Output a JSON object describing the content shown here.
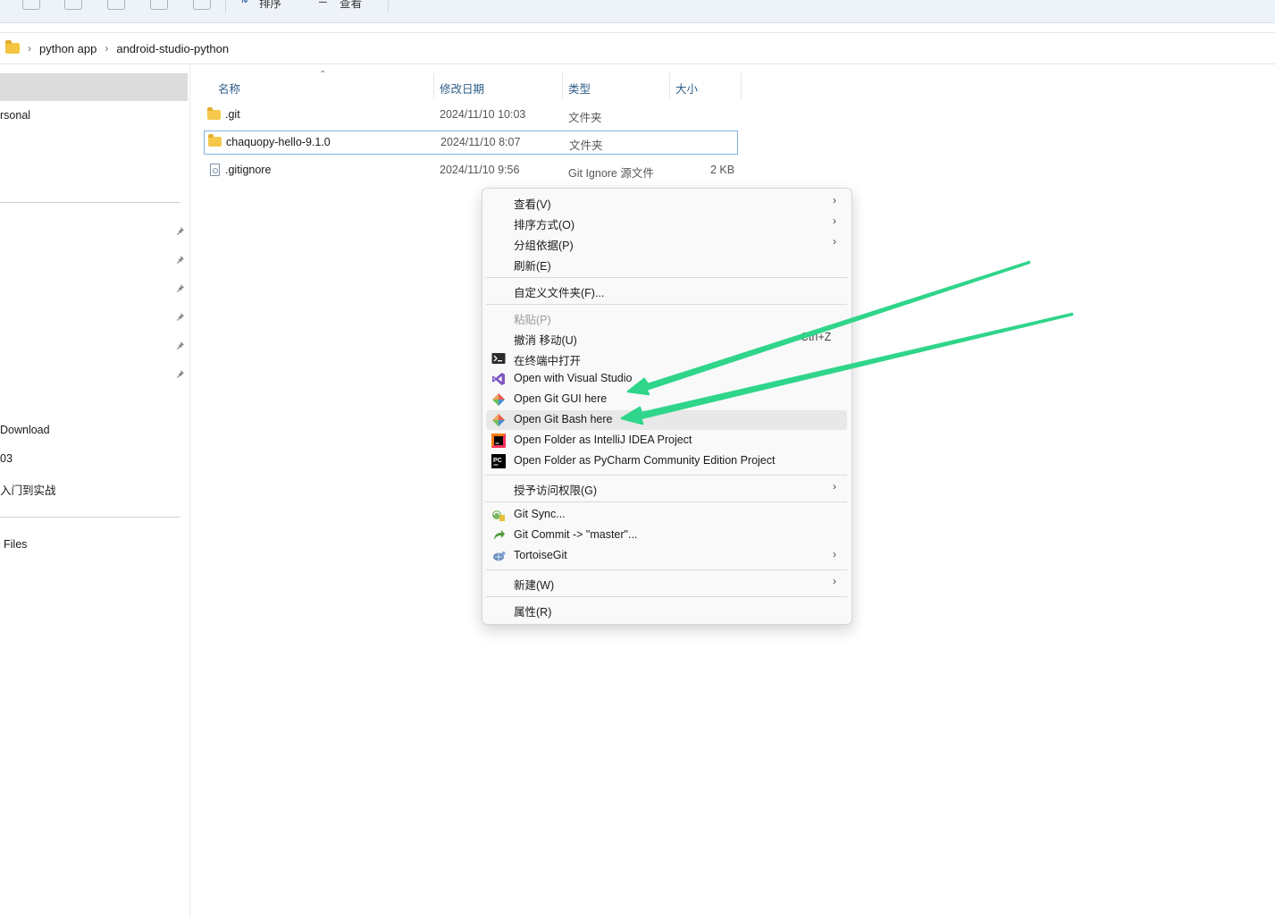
{
  "toolbar": {
    "sort_label": "排序",
    "view_label": "查看"
  },
  "breadcrumb": {
    "items": [
      "python app",
      "android-studio-python"
    ]
  },
  "navpane": {
    "items": [
      {
        "label": "rsonal"
      },
      {
        "label": "Download"
      },
      {
        "label": "03"
      },
      {
        "label": "入门到实战"
      },
      {
        "label": "Files"
      }
    ]
  },
  "columns": {
    "name": "名称",
    "date": "修改日期",
    "type": "类型",
    "size": "大小"
  },
  "files": [
    {
      "name": ".git",
      "date": "2024/11/10 10:03",
      "type": "文件夹",
      "size": ""
    },
    {
      "name": "chaquopy-hello-9.1.0",
      "date": "2024/11/10 8:07",
      "type": "文件夹",
      "size": ""
    },
    {
      "name": ".gitignore",
      "date": "2024/11/10 9:56",
      "type": "Git Ignore 源文件",
      "size": "2 KB"
    }
  ],
  "context_menu": {
    "view": "查看(V)",
    "sort_by": "排序方式(O)",
    "group_by": "分组依据(P)",
    "refresh": "刷新(E)",
    "customize": "自定义文件夹(F)...",
    "paste": "粘贴(P)",
    "undo_move": "撤消 移动(U)",
    "undo_shortcut": "Ctrl+Z",
    "open_terminal": "在终端中打开",
    "open_vs": "Open with Visual Studio",
    "git_gui": "Open Git GUI here",
    "git_bash": "Open Git Bash here",
    "intellij": "Open Folder as IntelliJ IDEA Project",
    "pycharm": "Open Folder as PyCharm Community Edition Project",
    "grant_access": "授予访问权限(G)",
    "git_sync": "Git Sync...",
    "git_commit": "Git Commit -> \"master\"...",
    "tortoisegit": "TortoiseGit",
    "new": "新建(W)",
    "properties": "属性(R)"
  },
  "colors": {
    "arrow": "#2fd58a",
    "header_text": "#2f5d8a",
    "selection_border": "#80b3e0"
  }
}
